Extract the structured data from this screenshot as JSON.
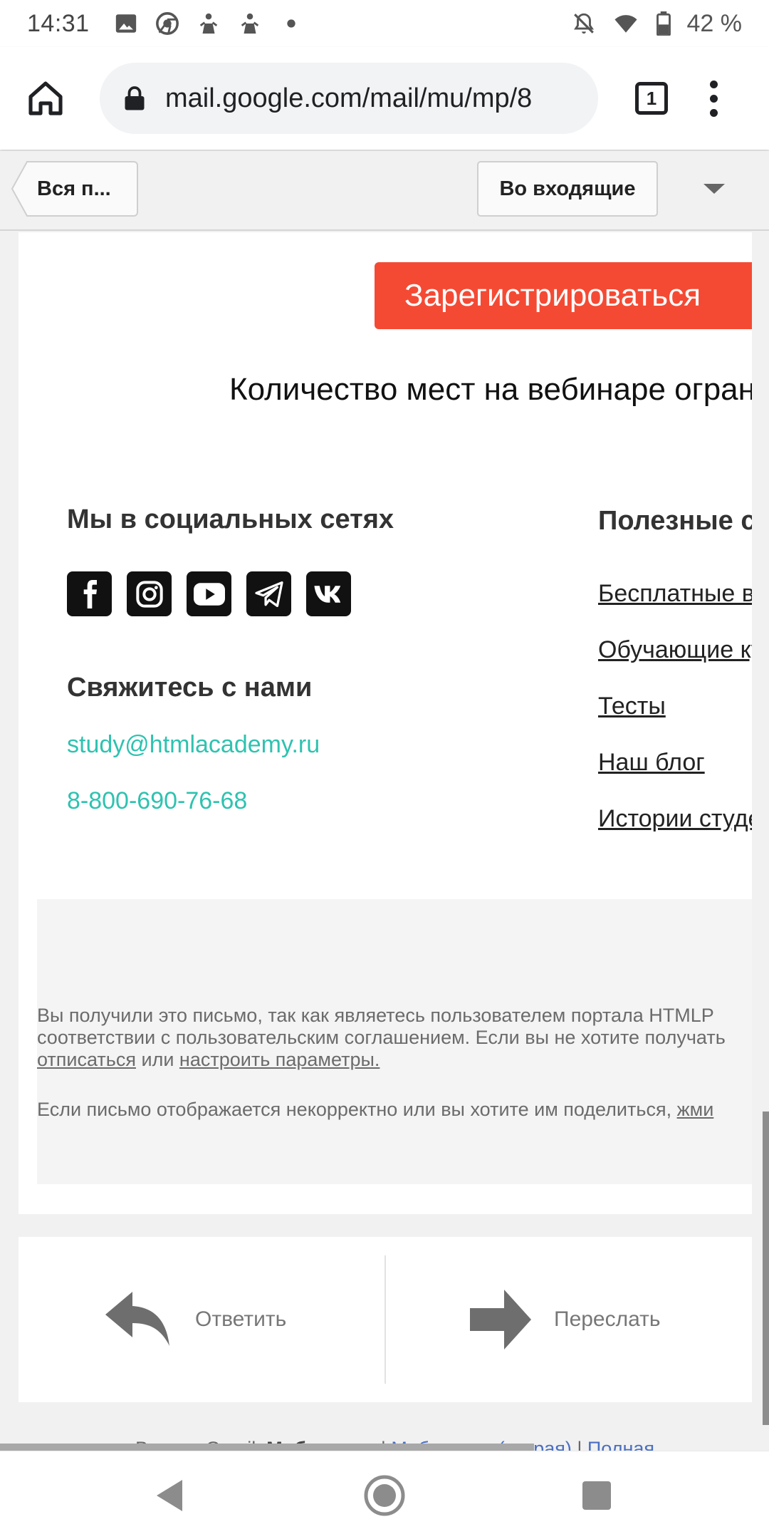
{
  "status_bar": {
    "time": "14:31",
    "battery": "42 %",
    "icons": [
      "image-icon",
      "chrome-icon",
      "app-icon",
      "app-icon",
      "dot-icon",
      "bell-off-icon",
      "wifi-icon",
      "battery-icon"
    ]
  },
  "browser": {
    "url": "mail.google.com/mail/mu/mp/8",
    "tab_count": "1"
  },
  "gmail_toolbar": {
    "back_label": "Вся п...",
    "inbox_label": "Во входящие"
  },
  "email": {
    "register_button": "Зарегистрироваться",
    "limit_text": "Количество мест на вебинаре ограничено",
    "social_title": "Мы в социальных сетях",
    "social_icons": [
      "facebook-icon",
      "instagram-icon",
      "youtube-icon",
      "telegram-icon",
      "vk-icon"
    ],
    "contact_title": "Свяжитесь с нами",
    "email": "study@htmlacademy.ru",
    "phone": "8-800-690-76-68",
    "useful_title": "Полезные ссылки",
    "useful_links": [
      "Бесплатные вебинары",
      "Обучающие курсы",
      "Тесты",
      "Наш блог",
      "Истории студентов"
    ],
    "footer_line1": "Вы получили это письмо, так как являетесь пользователем портала HTMLP",
    "footer_line2": "соответствии с пользовательским соглашением. Если вы не хотите получать",
    "unsubscribe": "отписаться",
    "or": "или",
    "settings": "настроить параметры.",
    "footer_line4": "Если письмо отображается некорректно или вы хотите им поделиться,",
    "footer_link4": "жми"
  },
  "actions": {
    "reply": "Ответить",
    "forward": "Переслать"
  },
  "version_line": {
    "prefix": "Версия Gmail:",
    "current": "Мобильная",
    "old": "Мобильная (старая)",
    "full": "Полная"
  },
  "colors": {
    "accent_orange": "#f44a34",
    "contact_teal": "#2fc2b0"
  }
}
